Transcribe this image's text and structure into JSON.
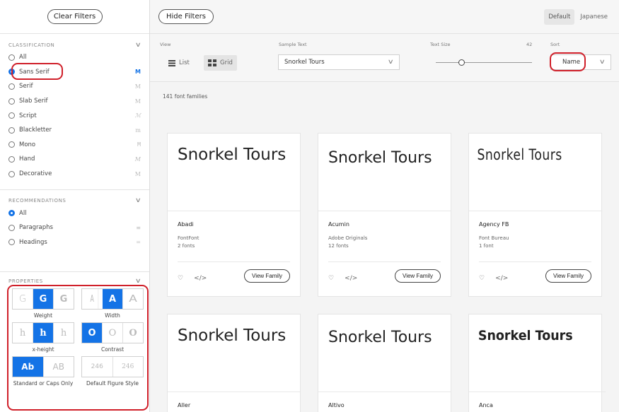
{
  "sidebar": {
    "clear_filters": "Clear Filters",
    "classification": {
      "title": "CLASSIFICATION",
      "items": [
        {
          "label": "All",
          "glyph": ""
        },
        {
          "label": "Sans Serif",
          "glyph": "M"
        },
        {
          "label": "Serif",
          "glyph": "M"
        },
        {
          "label": "Slab Serif",
          "glyph": "M"
        },
        {
          "label": "Script",
          "glyph": "ℳ"
        },
        {
          "label": "Blackletter",
          "glyph": "m"
        },
        {
          "label": "Mono",
          "glyph": "M"
        },
        {
          "label": "Hand",
          "glyph": "M"
        },
        {
          "label": "Decorative",
          "glyph": "M"
        }
      ]
    },
    "recommendations": {
      "title": "RECOMMENDATIONS",
      "items": [
        {
          "label": "All",
          "glyph": ""
        },
        {
          "label": "Paragraphs",
          "glyph": "≡"
        },
        {
          "label": "Headings",
          "glyph": "="
        }
      ]
    },
    "properties": {
      "title": "PROPERTIES",
      "groups": [
        {
          "label": "Weight",
          "options": [
            "G",
            "G",
            "G"
          ]
        },
        {
          "label": "Width",
          "options": [
            "A",
            "A",
            "A"
          ]
        },
        {
          "label": "x-height",
          "options": [
            "h",
            "h",
            "h"
          ]
        },
        {
          "label": "Contrast",
          "options": [
            "O",
            "O",
            "O"
          ]
        },
        {
          "label": "Standard or Caps Only",
          "options": [
            "Ab",
            "AB"
          ]
        },
        {
          "label": "Default Figure Style",
          "options": [
            "246",
            "246"
          ]
        }
      ]
    }
  },
  "toolbar": {
    "hide_filters": "Hide Filters",
    "lang_default": "Default",
    "lang_japanese": "Japanese"
  },
  "controls": {
    "view_label": "View",
    "list_label": "List",
    "grid_label": "Grid",
    "sample_label": "Sample Text",
    "sample_value": "Snorkel Tours",
    "size_label": "Text Size",
    "size_value": "42",
    "sort_label": "Sort",
    "sort_value": "Name"
  },
  "results": {
    "count": "141 font families"
  },
  "cards": [
    {
      "sample": "Snorkel Tours",
      "name": "Abadi",
      "foundry": "FontFont",
      "fonts": "2 fonts",
      "button": "View Family"
    },
    {
      "sample": "Snorkel Tours",
      "name": "Acumin",
      "foundry": "Adobe Originals",
      "fonts": "12 fonts",
      "button": "View Family"
    },
    {
      "sample": "Snorkel Tours",
      "name": "Agency FB",
      "foundry": "Font Bureau",
      "fonts": "1 font",
      "button": "View Family"
    },
    {
      "sample": "Snorkel Tours",
      "name": "Aller"
    },
    {
      "sample": "Snorkel Tours",
      "name": "Altivo"
    },
    {
      "sample": "Snorkel Tours",
      "name": "Anca"
    }
  ],
  "icons": {
    "heart": "♡",
    "code": "</>",
    "chevron": "∨"
  },
  "colors": {
    "accent": "#1473e6",
    "highlight": "#d0202a"
  }
}
